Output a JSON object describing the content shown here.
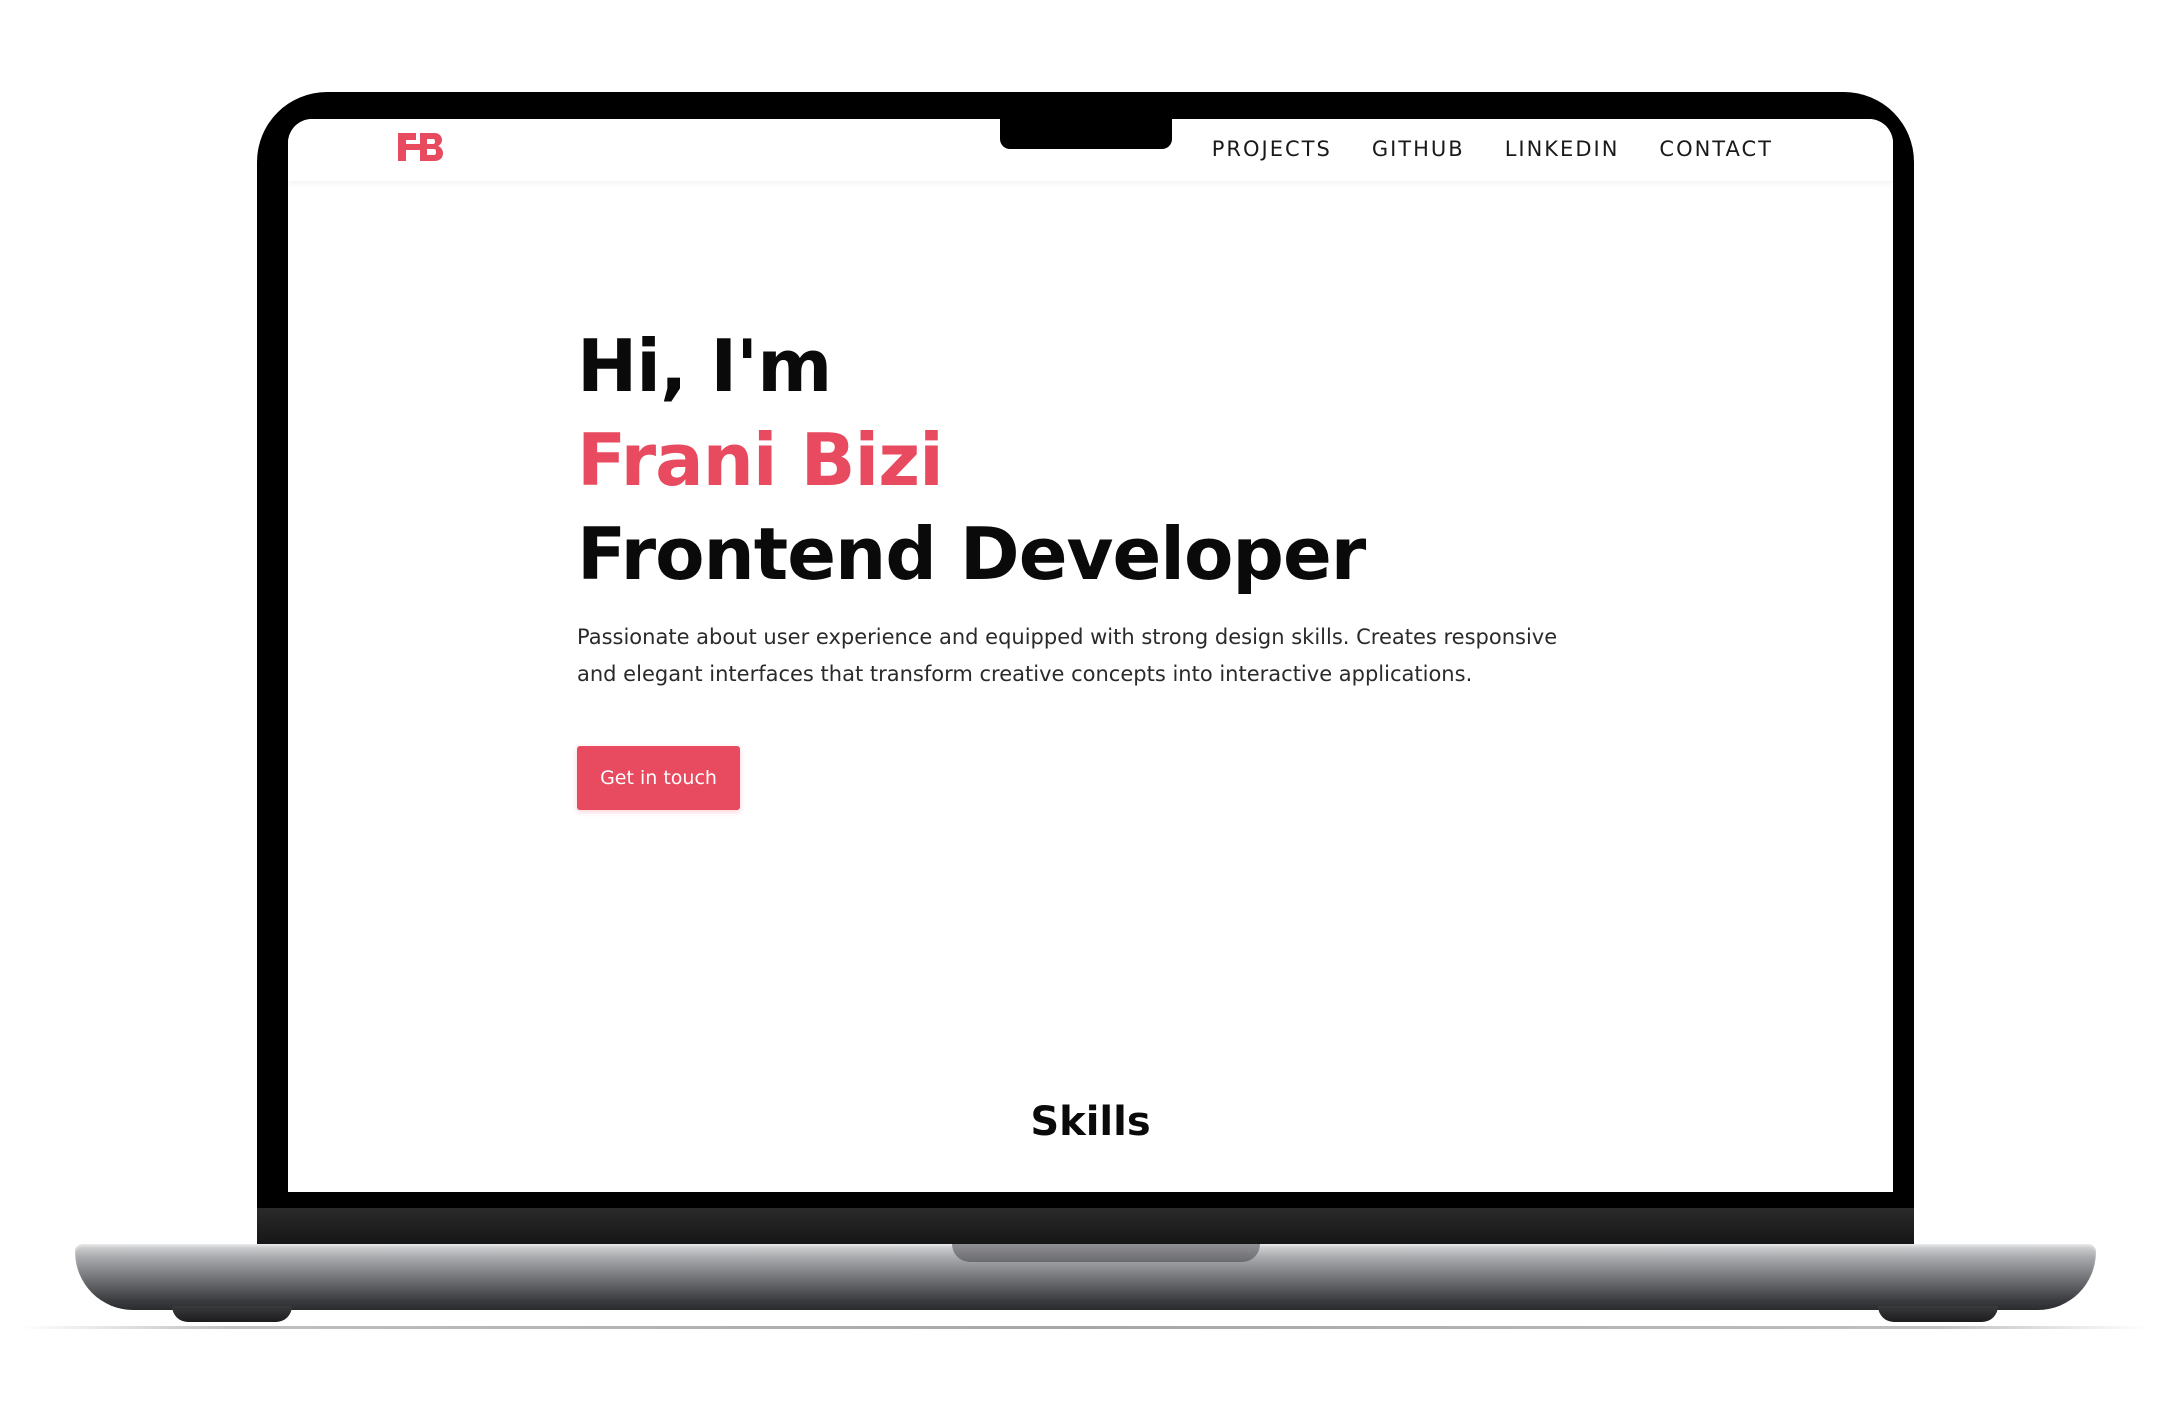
{
  "site": {
    "logo_text": "FB",
    "nav": {
      "links": [
        "PROJECTS",
        "GITHUB",
        "LINKEDIN",
        "CONTACT"
      ]
    },
    "hero": {
      "greeting": "Hi, I'm",
      "name": "Frani Bizi",
      "role": "Frontend Developer",
      "description": "Passionate about user experience and equipped with strong design skills. Creates responsive and elegant interfaces that transform creative concepts into interactive applications.",
      "cta_label": "Get in touch"
    },
    "skills": {
      "title": "Skills"
    }
  },
  "colors": {
    "accent": "#e84a5f",
    "text": "#0a0a0a",
    "bezel": "#000000"
  }
}
